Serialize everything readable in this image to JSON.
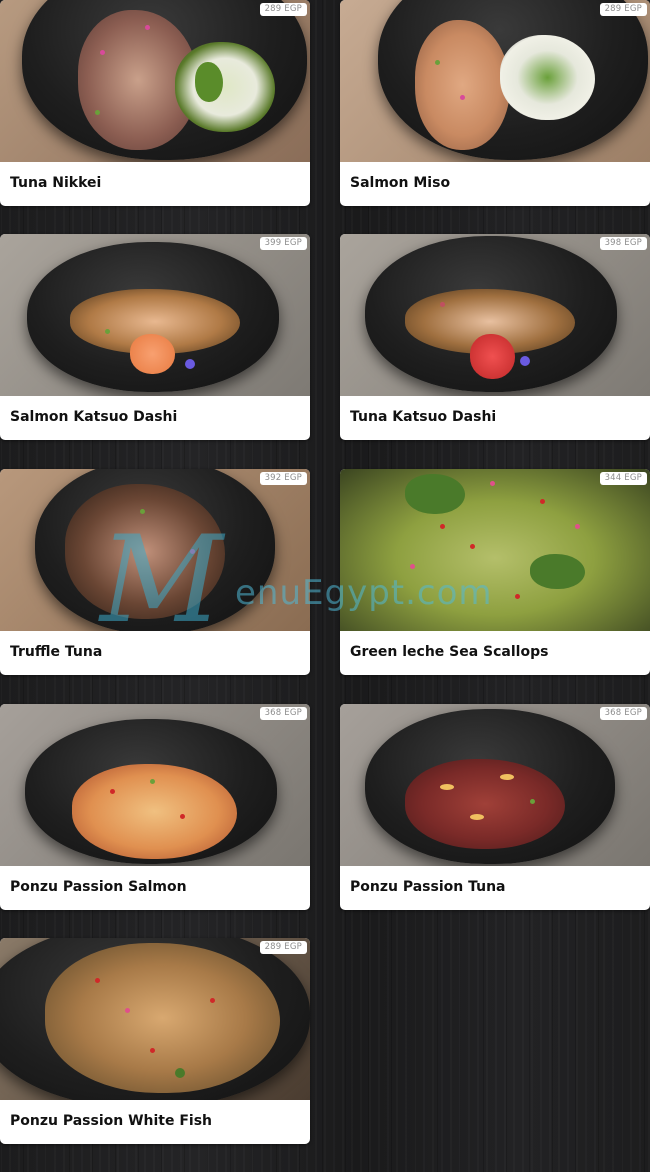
{
  "menu": {
    "items": [
      {
        "name": "Tuna Nikkei",
        "price": "289 EGP"
      },
      {
        "name": "Salmon Miso",
        "price": "289 EGP"
      },
      {
        "name": "Salmon Katsuo Dashi",
        "price": "399 EGP"
      },
      {
        "name": "Tuna Katsuo Dashi",
        "price": "398 EGP"
      },
      {
        "name": "Truffle Tuna",
        "price": "392 EGP"
      },
      {
        "name": "Green leche Sea Scallops",
        "price": "344 EGP"
      },
      {
        "name": "Ponzu Passion Salmon",
        "price": "368 EGP"
      },
      {
        "name": "Ponzu Passion Tuna",
        "price": "368 EGP"
      },
      {
        "name": "Ponzu Passion White Fish",
        "price": "289 EGP"
      }
    ]
  },
  "watermark": {
    "letter": "M",
    "text": "enuEgypt.com"
  },
  "colors": {
    "background": "#1f1f20",
    "card": "#ffffff",
    "name_text": "#111111",
    "price_text": "#8d8d8d",
    "watermark": "#3cb0d0"
  }
}
